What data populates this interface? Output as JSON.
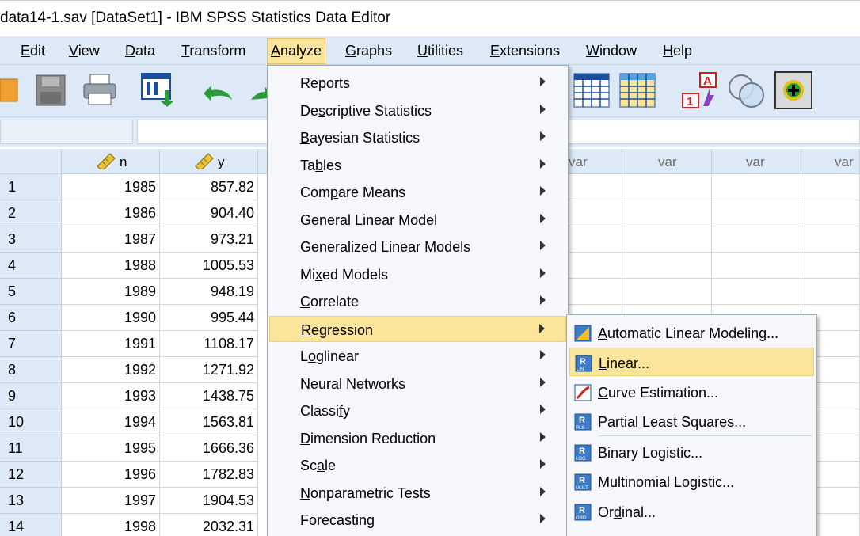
{
  "window": {
    "title": "data14-1.sav [DataSet1] - IBM SPSS Statistics Data Editor"
  },
  "menubar": {
    "items": [
      {
        "label": "Edit"
      },
      {
        "label": "View"
      },
      {
        "label": "Data"
      },
      {
        "label": "Transform"
      },
      {
        "label": "Analyze"
      },
      {
        "label": "Graphs"
      },
      {
        "label": "Utilities"
      },
      {
        "label": "Extensions"
      },
      {
        "label": "Window"
      },
      {
        "label": "Help"
      }
    ],
    "active": "Analyze"
  },
  "toolbar": {
    "icons": [
      "open-icon",
      "save-icon",
      "print-icon",
      "dialog-recall-icon",
      "undo-icon",
      "redo-icon",
      "split-file-icon",
      "select-cases-icon",
      "value-labels-icon",
      "use-sets-icon",
      "customize-icon"
    ]
  },
  "grid": {
    "columns": [
      {
        "name": "n",
        "type": "scale"
      },
      {
        "name": "y",
        "type": "scale"
      },
      {
        "name": "var"
      },
      {
        "name": "var"
      },
      {
        "name": "var"
      },
      {
        "name": "var"
      }
    ],
    "rows": [
      {
        "num": "1",
        "n": "1985",
        "y": "857.82"
      },
      {
        "num": "2",
        "n": "1986",
        "y": "904.40"
      },
      {
        "num": "3",
        "n": "1987",
        "y": "973.21"
      },
      {
        "num": "4",
        "n": "1988",
        "y": "1005.53"
      },
      {
        "num": "5",
        "n": "1989",
        "y": "948.19"
      },
      {
        "num": "6",
        "n": "1990",
        "y": "995.44"
      },
      {
        "num": "7",
        "n": "1991",
        "y": "1108.17"
      },
      {
        "num": "8",
        "n": "1992",
        "y": "1271.92"
      },
      {
        "num": "9",
        "n": "1993",
        "y": "1438.75"
      },
      {
        "num": "10",
        "n": "1994",
        "y": "1563.81"
      },
      {
        "num": "11",
        "n": "1995",
        "y": "1666.36"
      },
      {
        "num": "12",
        "n": "1996",
        "y": "1782.83"
      },
      {
        "num": "13",
        "n": "1997",
        "y": "1904.53"
      },
      {
        "num": "14",
        "n": "1998",
        "y": "2032.31"
      }
    ]
  },
  "analyze_menu": {
    "items": [
      {
        "label": "Reports",
        "u": 2
      },
      {
        "label": "Descriptive Statistics",
        "u": 2
      },
      {
        "label": "Bayesian Statistics",
        "u": 0
      },
      {
        "label": "Tables",
        "u": 2
      },
      {
        "label": "Compare Means",
        "u": 3
      },
      {
        "label": "General Linear Model",
        "u": 0
      },
      {
        "label": "Generalized Linear Models",
        "u": 9
      },
      {
        "label": "Mixed Models",
        "u": 2
      },
      {
        "label": "Correlate",
        "u": 0
      },
      {
        "label": "Regression",
        "u": 0
      },
      {
        "label": "Loglinear",
        "u": 1
      },
      {
        "label": "Neural Networks",
        "u": 10
      },
      {
        "label": "Classify",
        "u": 6
      },
      {
        "label": "Dimension Reduction",
        "u": 0
      },
      {
        "label": "Scale",
        "u": 2
      },
      {
        "label": "Nonparametric Tests",
        "u": 0
      },
      {
        "label": "Forecasting",
        "u": 7
      }
    ],
    "highlighted": "Regression"
  },
  "regression_menu": {
    "items": [
      {
        "label": "Automatic Linear Modeling...",
        "u": 0,
        "icon": "automatic-linear-modeling-icon"
      },
      {
        "label": "Linear...",
        "u": 0,
        "icon": "linear-regression-icon"
      },
      {
        "label": "Curve Estimation...",
        "u": 0,
        "icon": "curve-estimation-icon"
      },
      {
        "label": "Partial Least Squares...",
        "u": 10,
        "icon": "partial-least-squares-icon"
      },
      {
        "label": "Binary Logistic...",
        "u": 9,
        "icon": "binary-logistic-icon"
      },
      {
        "label": "Multinomial Logistic...",
        "u": 0,
        "icon": "multinomial-logistic-icon"
      },
      {
        "label": "Ordinal...",
        "u": 2,
        "icon": "ordinal-regression-icon"
      }
    ],
    "highlighted": "Linear...",
    "icon_tags": [
      "",
      "LIN",
      "",
      "PLS",
      "LOG",
      "MULT",
      "ORD"
    ]
  }
}
